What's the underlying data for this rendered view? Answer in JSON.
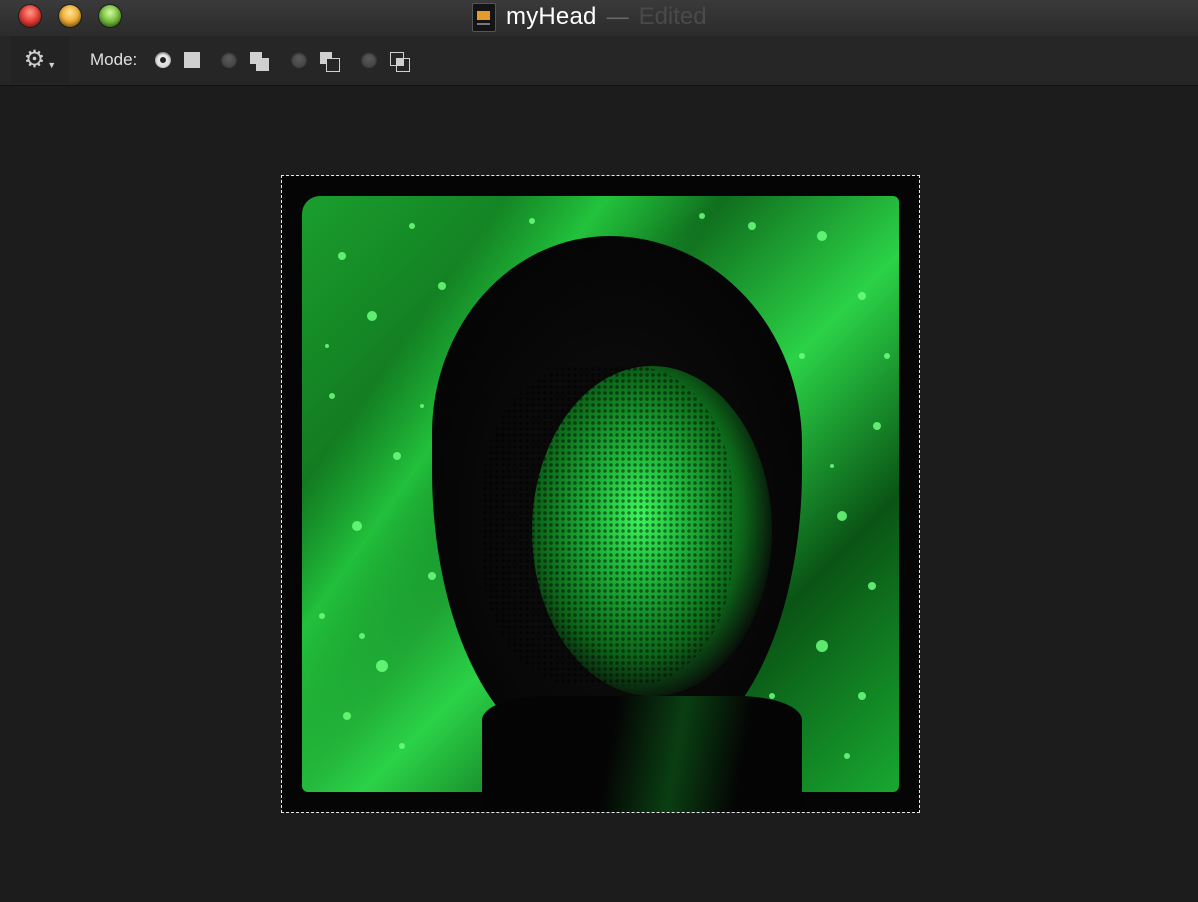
{
  "window": {
    "title": "myHead",
    "separator": "—",
    "status": "Edited",
    "document_icon": "image-document-icon",
    "buttons": [
      "close",
      "minimize",
      "zoom"
    ],
    "colors": {
      "close": "#e8423a",
      "minimize": "#f1b23a",
      "zoom": "#7cc443"
    }
  },
  "toolbar": {
    "action_menu_icon": "gear-icon",
    "mode_label": "Mode:",
    "modes": [
      {
        "name": "new-selection",
        "icon": "single-square-icon",
        "selected": true
      },
      {
        "name": "add-to-selection",
        "icon": "add-squares-icon",
        "selected": false
      },
      {
        "name": "subtract-from-selection",
        "icon": "subtract-squares-icon",
        "selected": false
      },
      {
        "name": "intersect-selection",
        "icon": "intersect-squares-icon",
        "selected": false
      }
    ]
  },
  "canvas": {
    "image_description_colors": {
      "accent": "#2bd247",
      "background": "#1c1c1c"
    },
    "selection": "marching-ants"
  }
}
